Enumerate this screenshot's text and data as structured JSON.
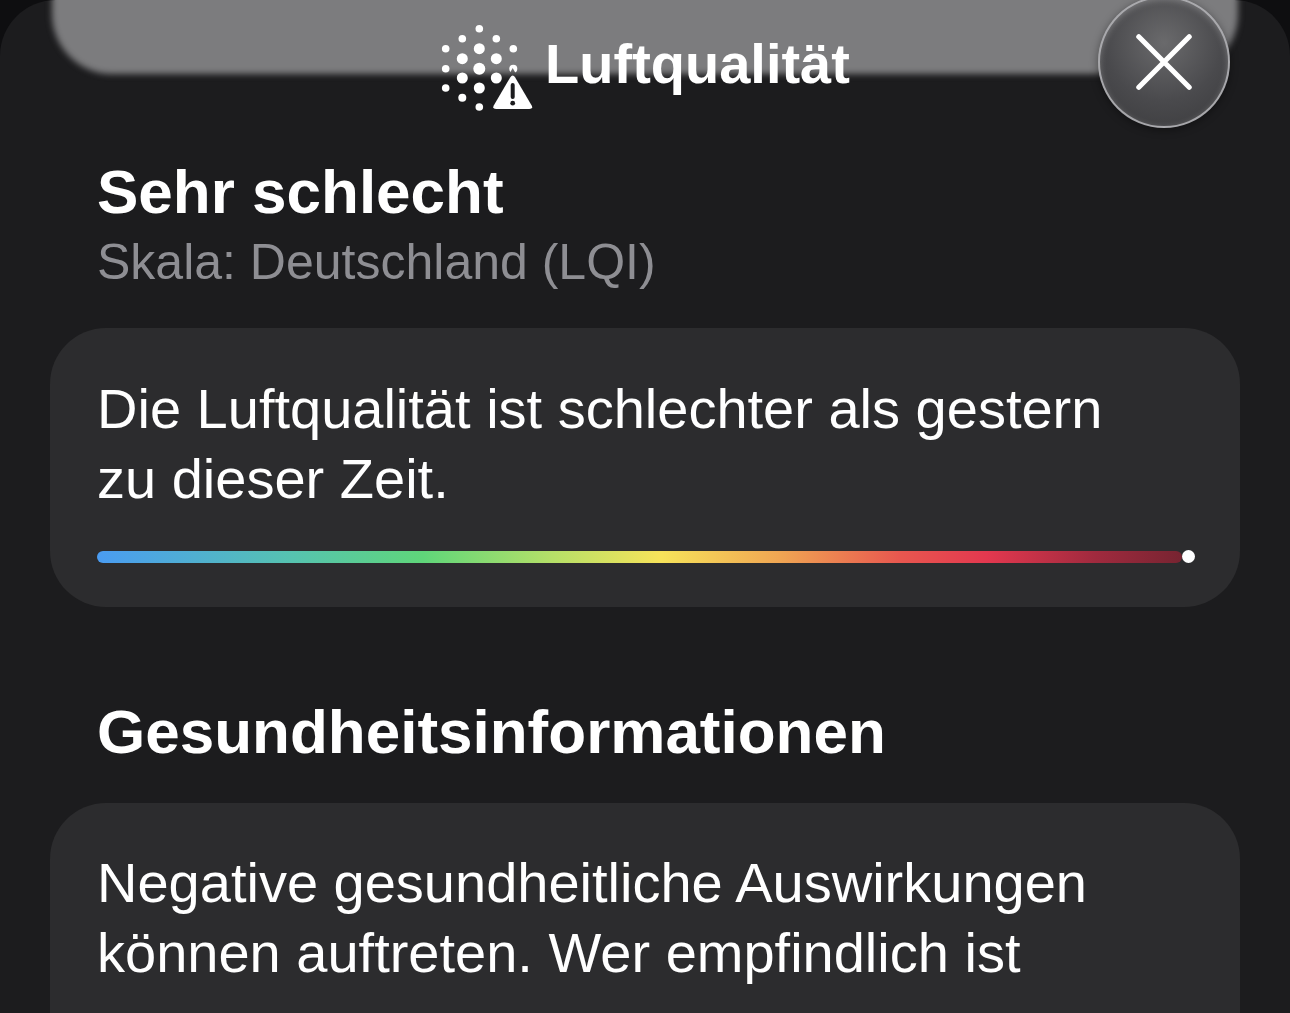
{
  "header": {
    "title": "Luftqualität"
  },
  "summary": {
    "rating": "Sehr schlecht",
    "scale": "Skala: Deutschland (LQI)"
  },
  "comparison": {
    "lines": [
      "Die Luftqualität ist schlechter als gestern",
      "zu dieser Zeit."
    ],
    "scale": {
      "level": 1
    }
  },
  "health": {
    "heading": "Gesundheitsinformationen",
    "lines": [
      "Negative gesundheitliche Auswirkungen",
      "können auftreten. Wer empfindlich ist"
    ]
  }
}
